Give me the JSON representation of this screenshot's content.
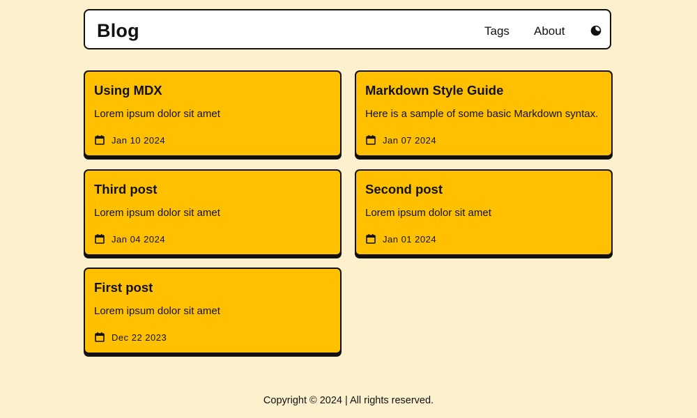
{
  "header": {
    "brand": "Blog",
    "nav": [
      {
        "label": "Tags"
      },
      {
        "label": "About"
      }
    ],
    "theme_toggle_icon": "moon-sun-icon"
  },
  "posts": [
    {
      "title": "Using MDX",
      "description": "Lorem ipsum dolor sit amet",
      "date": "Jan 10 2024"
    },
    {
      "title": "Markdown Style Guide",
      "description": "Here is a sample of some basic Markdown syntax.",
      "date": "Jan 07 2024"
    },
    {
      "title": "Third post",
      "description": "Lorem ipsum dolor sit amet",
      "date": "Jan 04 2024"
    },
    {
      "title": "Second post",
      "description": "Lorem ipsum dolor sit amet",
      "date": "Jan 01 2024"
    },
    {
      "title": "First post",
      "description": "Lorem ipsum dolor sit amet",
      "date": "Dec 22 2023"
    }
  ],
  "post_date_icon": "calendar-icon",
  "footer": {
    "text": "Copyright © 2024 | All rights reserved."
  },
  "colors": {
    "page_background": "#fdf0cc",
    "card_background": "#ffc000",
    "border": "#111111",
    "header_background": "#ffffff"
  }
}
